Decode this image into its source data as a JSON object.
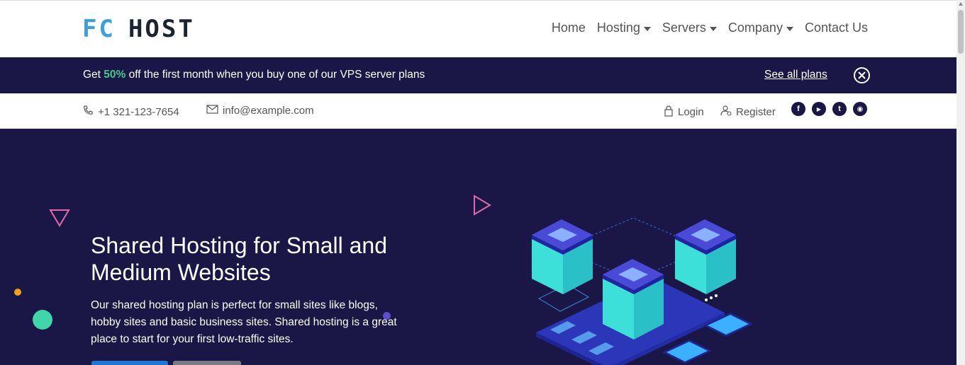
{
  "header": {
    "logo_part1": "FC",
    "logo_part2": "HOST",
    "nav": [
      {
        "label": "Home"
      },
      {
        "label": "Hosting"
      },
      {
        "label": "Servers"
      },
      {
        "label": "Company"
      },
      {
        "label": "Contact Us"
      }
    ]
  },
  "promo": {
    "text_before": "Get ",
    "highlight": "50%",
    "text_after": " off the first month when you buy one of our VPS server plans",
    "link_label": "See all plans"
  },
  "contact": {
    "phone": "+1 321-123-7654",
    "email": "info@example.com",
    "login_label": "Login",
    "register_label": "Register"
  },
  "socials": [
    {
      "icon": "facebook-icon",
      "glyph": "f"
    },
    {
      "icon": "youtube-icon",
      "glyph": "▶"
    },
    {
      "icon": "twitter-icon",
      "glyph": "t"
    },
    {
      "icon": "discord-icon",
      "glyph": "◉"
    }
  ],
  "hero": {
    "title": "Shared Hosting for Small and Medium Websites",
    "description": "Our shared hosting plan is perfect for small sites like blogs, hobby sites and basic business sites. Shared hosting is a great place to start for your first low-traffic sites."
  },
  "colors": {
    "brand": "#3aa0e0",
    "dark": "#1a1646",
    "accent_green": "#40c98c",
    "primary_button": "#1e76d2"
  }
}
